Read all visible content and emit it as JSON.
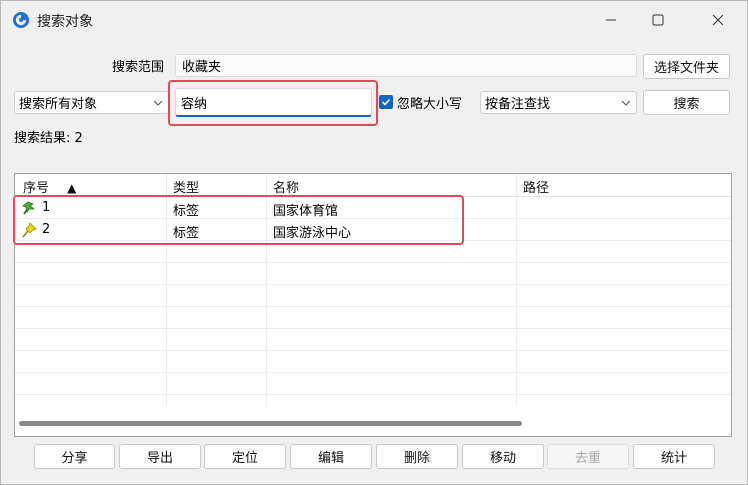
{
  "window": {
    "title": "搜索对象",
    "icon": "app-logo-icon",
    "controls": [
      "minimize-icon",
      "maximize-icon",
      "close-icon"
    ]
  },
  "scope": {
    "label": "搜索范围",
    "value": "收藏夹",
    "choose_button": "选择文件夹"
  },
  "search": {
    "object_filter": "搜索所有对象",
    "query": "容纳",
    "ignore_case_label": "忽略大小写",
    "ignore_case_checked": true,
    "mode": "按备注查找",
    "search_button": "搜索"
  },
  "result": {
    "label": "搜索结果:",
    "count": "2"
  },
  "table": {
    "columns": [
      "序号",
      "类型",
      "名称",
      "路径"
    ],
    "sort_indicator": "▲",
    "rows": [
      {
        "index": "1",
        "type": "标签",
        "name": "国家体育馆",
        "path": "",
        "icon": "green-placemark-icon"
      },
      {
        "index": "2",
        "type": "标签",
        "name": "国家游泳中心",
        "path": "",
        "icon": "yellow-pushpin-icon"
      }
    ]
  },
  "actions": {
    "share": "分享",
    "export": "导出",
    "locate": "定位",
    "edit": "编辑",
    "delete": "删除",
    "move": "移动",
    "dedupe": "去重",
    "stats": "统计"
  },
  "colors": {
    "highlight_box": "#e04a5a",
    "accent": "#1565c0",
    "window_bg": "#f0f0f0"
  }
}
